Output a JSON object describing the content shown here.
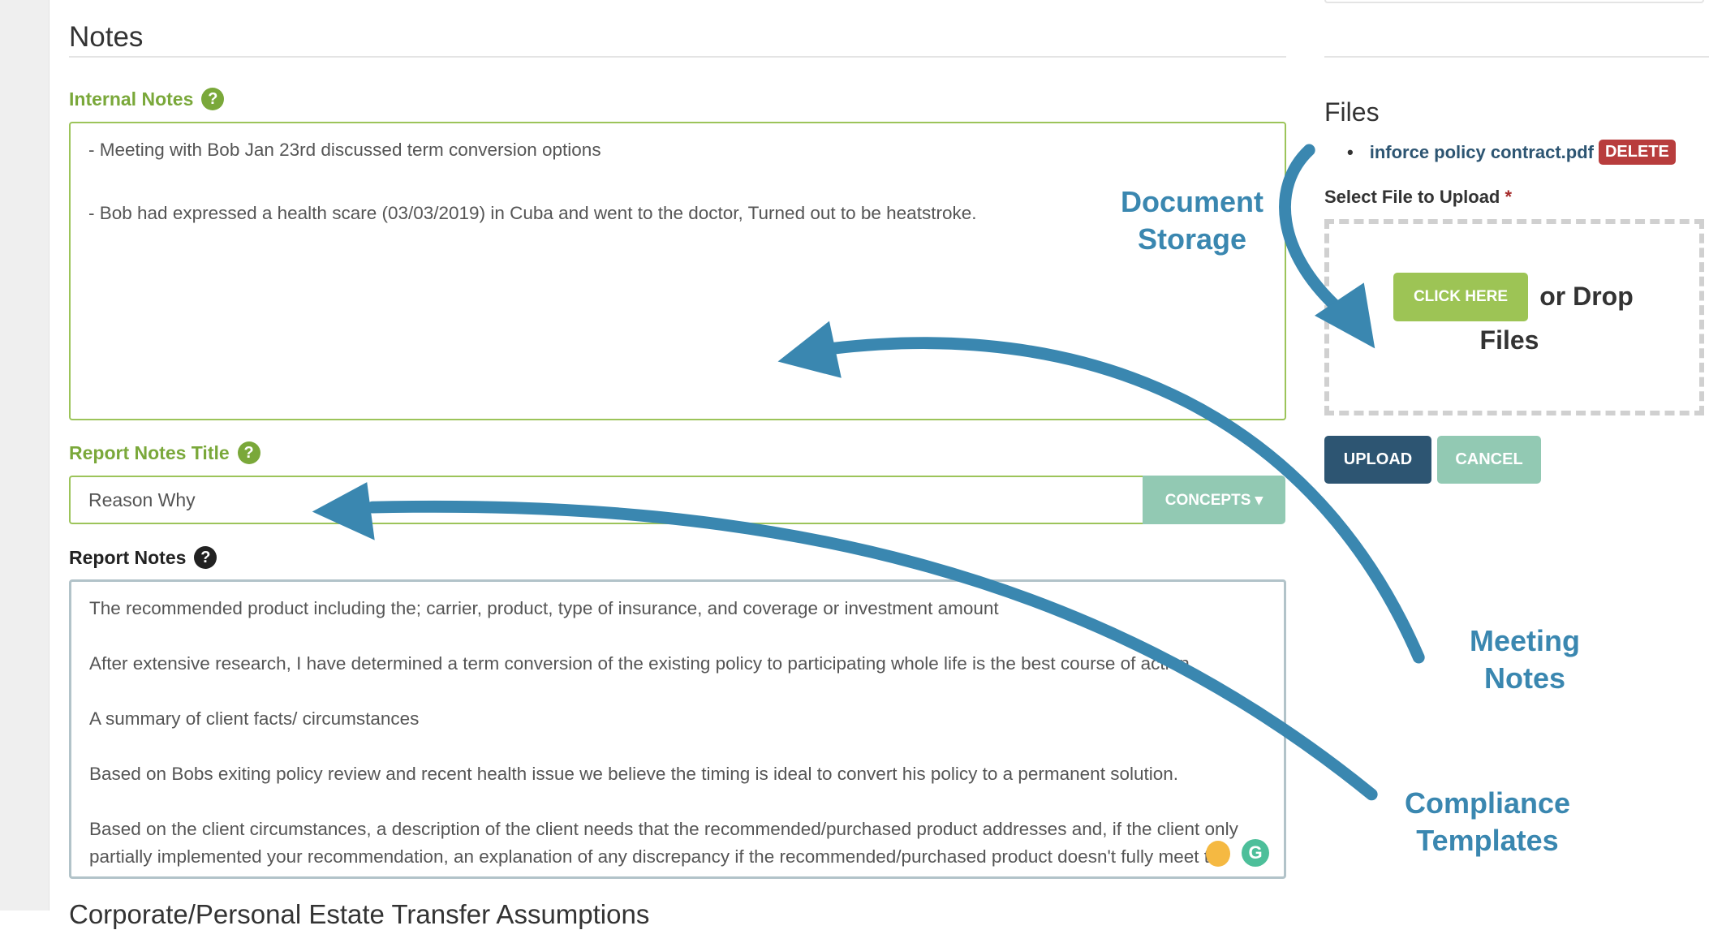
{
  "notes": {
    "title": "Notes",
    "internal_label": "Internal Notes",
    "internal_lines": [
      "- Meeting with  Bob Jan 23rd discussed term conversion options",
      "- Bob had expressed a health scare (03/03/2019) in Cuba and went to the doctor, Turned out to be heatstroke."
    ],
    "report_title_label": "Report Notes Title",
    "report_title_value": "Reason Why",
    "concepts_label": "CONCEPTS ▾",
    "report_label": "Report Notes",
    "report_lines": [
      "The recommended product including the; carrier, product, type of insurance, and coverage or investment amount",
      "After extensive research, I have determined a term conversion of the existing policy to participating whole life is the best course of action.",
      "A summary of client facts/ circumstances",
      "Based on Bobs exiting policy review and recent health issue we believe the timing is ideal to convert his policy to a permanent solution.",
      "Based on the client circumstances, a description of the client needs that the recommended/purchased product addresses and, if the client only partially implemented your recommendation, an explanation of any discrepancy if the recommended/purchased product doesn't fully meet the client needs"
    ],
    "next_section": "Corporate/Personal Estate Transfer Assumptions",
    "help_glyph": "?"
  },
  "files": {
    "title": "Files",
    "file_name": "inforce policy contract.pdf",
    "delete_label": "DELETE",
    "select_label": "Select File to Upload",
    "required": "*",
    "click_here": "CLICK HERE",
    "drop_text": "or Drop Files",
    "upload_label": "UPLOAD",
    "cancel_label": "CANCEL"
  },
  "annotations": {
    "document_storage": "Document Storage",
    "meeting_notes": "Meeting Notes",
    "compliance_templates": "Compliance Templates"
  },
  "colors": {
    "green": "#7aa83a",
    "annotation": "#3a87b0",
    "delete": "#b83d3d",
    "upload": "#2d5572",
    "cancel": "#92c9b3"
  }
}
